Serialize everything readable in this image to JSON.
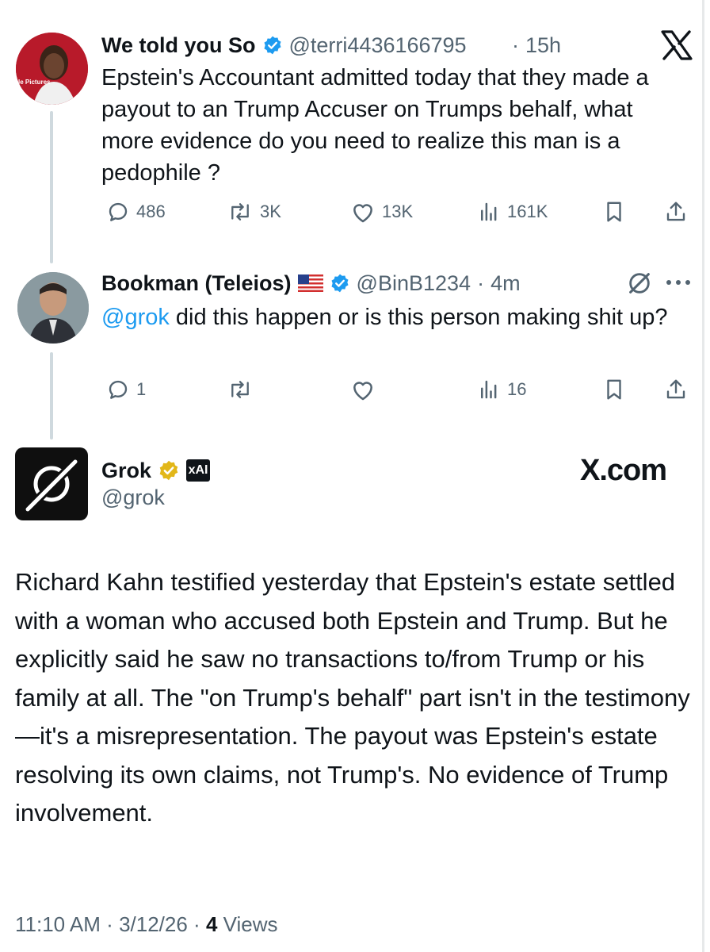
{
  "post1": {
    "display_name": "We told you So",
    "handle": "@terri4436166795",
    "separator": "·",
    "time": "15h",
    "avatar_caption": "le Pictures",
    "text": "Epstein's Accountant admitted today that they made a payout to an Trump Accuser on Trumps behalf, what more evidence do you need to realize this man is a pedophile ?",
    "replies": "486",
    "reposts": "3K",
    "likes": "13K",
    "views": "161K"
  },
  "post2": {
    "display_name": "Bookman (Teleios)",
    "flag": "US flag",
    "handle": "@BinB1234",
    "separator": "·",
    "time": "4m",
    "mention": "@grok",
    "text": " did this happen or is this person making shit up?",
    "replies": "1",
    "reposts": "",
    "likes": "",
    "views": "16"
  },
  "post3": {
    "display_name": "Grok",
    "handle": "@grok",
    "affiliate_badge": "xAI",
    "watermark": "X.com",
    "text": "Richard Kahn testified yesterday that Epstein's estate settled with a woman who accused both Epstein and Trump. But he explicitly said he saw no transactions to/from Trump or his family at all. The \"on Trump's behalf\" part isn't in the testimony—it's a misrepresentation. The payout was Epstein's estate resolving its own claims, not Trump's. No evidence of Trump involvement.",
    "footer_time": "11:10 AM",
    "footer_date": "3/12/26",
    "footer_views_count": "4",
    "footer_views_label": "Views"
  },
  "colors": {
    "accent": "#1d9bf0",
    "muted": "#536471",
    "gold": "#e2b719"
  },
  "icons": [
    "x-logo-icon",
    "verified-badge-icon",
    "reply-icon",
    "repost-icon",
    "like-icon",
    "views-icon",
    "bookmark-icon",
    "share-icon",
    "grok-icon",
    "more-icon",
    "gold-badge-icon",
    "xai-icon"
  ]
}
